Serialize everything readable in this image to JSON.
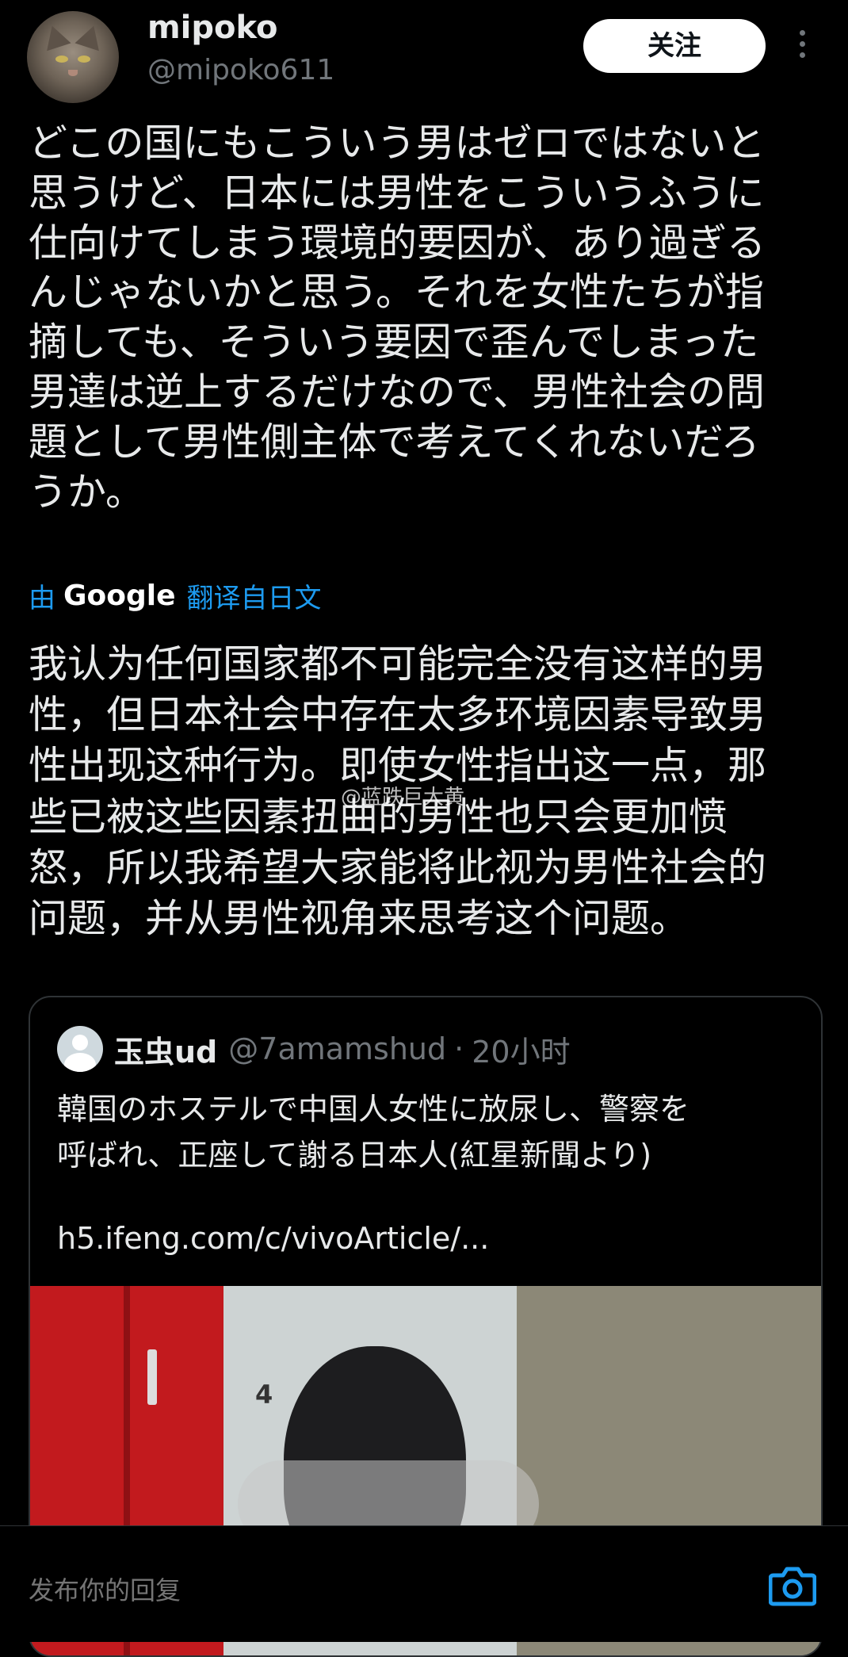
{
  "author": {
    "display_name": "mipoko",
    "handle": "@mipoko611",
    "follow_label": "关注"
  },
  "tweet": {
    "text": "どこの国にもこういう男はゼロではないと\n思うけど、日本には男性をこういうふうに\n仕向けてしまう環境的要因が、あり過ぎる\nんじゃないかと思う。それを女性たちが指\n摘しても、そういう要因で歪んでしまった\n男達は逆上するだけなので、男性社会の問\n題として男性側主体で考えてくれないだろ\nうか。"
  },
  "translation": {
    "by": "由",
    "provider": "Google",
    "from_label": "翻译自日文",
    "text": "我认为任何国家都不可能完全没有这样的男\n性，但日本社会中存在太多环境因素导致男\n性出现这种行为。即使女性指出这一点，那\n些已被这些因素扭曲的男性也只会更加愤\n怒，所以我希望大家能将此视为男性社会的\n问题，并从男性视角来思考这个问题。"
  },
  "watermark": "@蓝跌巨大黄",
  "quoted": {
    "name": "玉虫ud",
    "handle": "@7amamshud",
    "separator": "·",
    "time": "20小时",
    "text": "韓国のホステルで中国人女性に放尿し、警察を\n呼ばれ、正座して謝る日本人(紅星新聞より)",
    "link": "h5.ifeng.com/c/vivoArticle/...",
    "image_label": "4"
  },
  "composer": {
    "placeholder": "发布你的回复"
  },
  "colors": {
    "background": "#000000",
    "text": "#e7e9ea",
    "muted": "#71767b",
    "accent": "#1d9bf0"
  },
  "icons": [
    "more-icon",
    "camera-icon",
    "default-avatar-icon"
  ]
}
